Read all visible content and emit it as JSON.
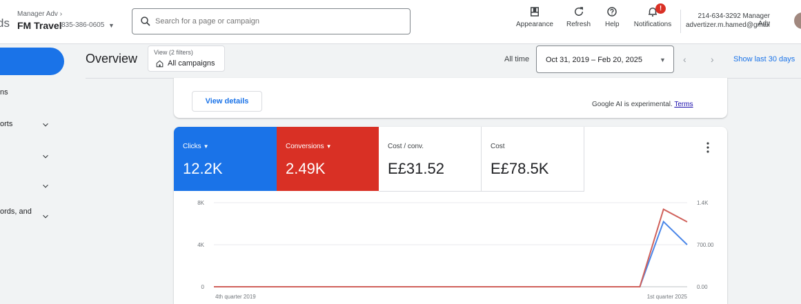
{
  "header": {
    "logo_fragment": "ds",
    "manager_label": "Manager Adv",
    "account_name": "FM Travel",
    "account_id": "835-386-0605",
    "search_placeholder": "Search for a page or campaign",
    "tools": [
      {
        "label": "Appearance",
        "icon": "appearance-icon"
      },
      {
        "label": "Refresh",
        "icon": "refresh-icon"
      },
      {
        "label": "Help",
        "icon": "help-icon"
      },
      {
        "label": "Notifications",
        "icon": "bell-icon",
        "badge": "!"
      }
    ],
    "user_phone": "214-634-3292 Manager Adv",
    "user_email": "advertizer.m.hamed@gmail.co..."
  },
  "sidebar": {
    "items": [
      {
        "label": "ns",
        "has_chevron": false
      },
      {
        "label": "orts",
        "has_chevron": true
      },
      {
        "label": "",
        "has_chevron": true
      },
      {
        "label": "",
        "has_chevron": true
      },
      {
        "label": "ords, and",
        "has_chevron": true
      }
    ]
  },
  "toolbar": {
    "page_title": "Overview",
    "filter_subtitle": "View (2 filters)",
    "filter_label": "All campaigns",
    "all_time_label": "All time",
    "date_range": "Oct 31, 2019 – Feb 20, 2025",
    "show_last_label": "Show last 30 days"
  },
  "insight": {
    "view_details_label": "View details",
    "ai_note": "Google AI is experimental.",
    "terms_label": "Terms"
  },
  "metrics": [
    {
      "label": "Clicks",
      "value": "12.2K",
      "selected": true,
      "color": "#1a73e8"
    },
    {
      "label": "Conversions",
      "value": "2.49K",
      "selected": true,
      "color": "#d93025"
    },
    {
      "label": "Cost / conv.",
      "value": "E£31.52",
      "selected": false
    },
    {
      "label": "Cost",
      "value": "E£78.5K",
      "selected": false
    }
  ],
  "chart_data": {
    "type": "line",
    "x": [
      "4th quarter 2019",
      "1st quarter 2025"
    ],
    "x_labels": [
      "4th quarter 2019",
      "1st quarter 2025"
    ],
    "left_axis": {
      "ticks": [
        "0",
        "4K",
        "8K"
      ],
      "range": [
        0,
        8000
      ]
    },
    "right_axis": {
      "ticks": [
        "0.00",
        "700.00",
        "1.4K"
      ],
      "range": [
        0,
        1400
      ]
    },
    "series": [
      {
        "name": "Clicks",
        "color": "#4a86e8",
        "axis": "left",
        "points": [
          [
            0,
            0
          ],
          [
            0.9,
            0
          ],
          [
            0.95,
            6200
          ],
          [
            1.0,
            4000
          ]
        ]
      },
      {
        "name": "Conversions",
        "color": "#d0605a",
        "axis": "right",
        "points": [
          [
            0,
            0
          ],
          [
            0.9,
            0
          ],
          [
            0.95,
            1290
          ],
          [
            1.0,
            1080
          ]
        ]
      }
    ]
  }
}
